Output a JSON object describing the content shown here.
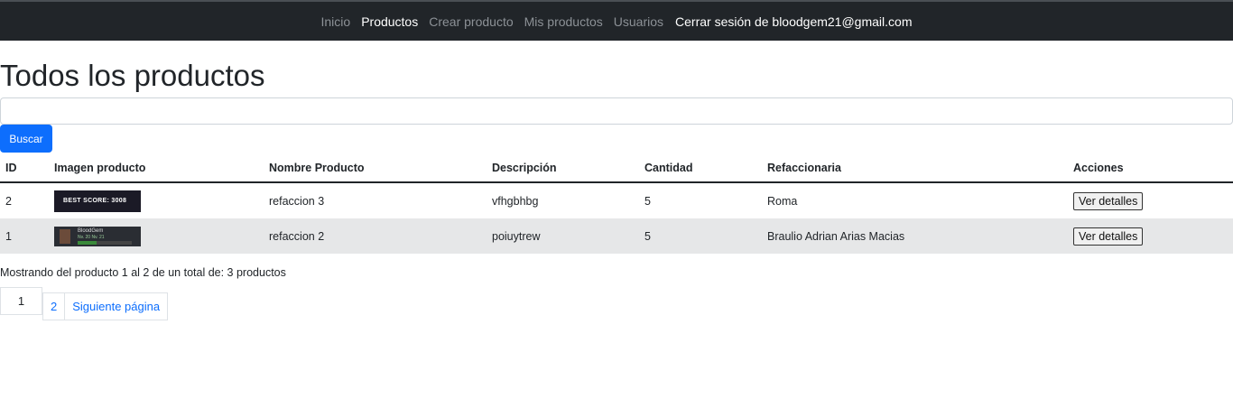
{
  "nav": {
    "items": [
      {
        "label": "Inicio",
        "active": false
      },
      {
        "label": "Productos",
        "active": true
      },
      {
        "label": "Crear producto",
        "active": false
      },
      {
        "label": "Mis productos",
        "active": false
      },
      {
        "label": "Usuarios",
        "active": false
      }
    ],
    "logout_label": "Cerrar sesión de bloodgem21@gmail.com"
  },
  "page": {
    "title": "Todos los productos",
    "search_value": "",
    "search_button": "Buscar"
  },
  "table": {
    "headers": [
      "ID",
      "Imagen producto",
      "Nombre Producto",
      "Descripción",
      "Cantidad",
      "Refaccionaria",
      "Acciones"
    ],
    "rows": [
      {
        "id": "2",
        "image_text": "BEST SCORE: 3008",
        "name": "refaccion 3",
        "description": "vfhgbhbg",
        "quantity": "5",
        "store": "Roma",
        "action": "Ver detalles"
      },
      {
        "id": "1",
        "image_text": "BloodGem",
        "image_sub": "Nv. 20 Nv. 21",
        "image_progress_text": "495/11.300",
        "image_progress": 0.35,
        "name": "refaccion 2",
        "description": "poiuytrew",
        "quantity": "5",
        "store": "Braulio Adrian Arias Macias",
        "action": "Ver detalles"
      }
    ]
  },
  "summary": "Mostrando del producto 1 al 2 de un total de: 3 productos",
  "pagination": {
    "current": "1",
    "next_page": "2",
    "next_label": "Siguiente página"
  }
}
